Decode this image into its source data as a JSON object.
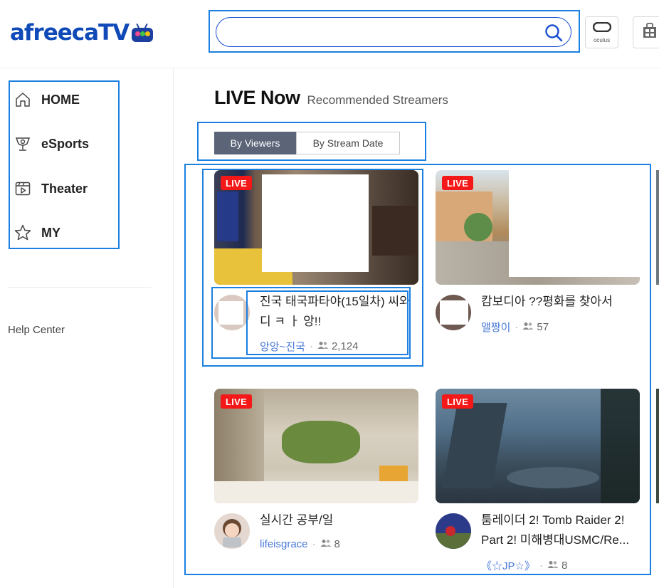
{
  "header": {
    "logo": "afreecaTV",
    "search": {
      "value": "",
      "placeholder": ""
    },
    "icons": [
      {
        "name": "oculus-icon",
        "caption": "oculus"
      },
      {
        "name": "store-icon",
        "caption": ""
      }
    ]
  },
  "sidebar": {
    "items": [
      {
        "label": "HOME",
        "icon": "home-icon"
      },
      {
        "label": "eSports",
        "icon": "trophy-icon"
      },
      {
        "label": "Theater",
        "icon": "play-icon"
      },
      {
        "label": "MY",
        "icon": "star-icon"
      }
    ],
    "help": "Help Center"
  },
  "main": {
    "title": "LIVE Now",
    "subtitle": "Recommended Streamers",
    "tabs": [
      {
        "label": "By Viewers",
        "active": true
      },
      {
        "label": "By Stream Date",
        "active": false
      }
    ],
    "badge": "LIVE",
    "cards": [
      {
        "title": "진국 태국파타야(15일차) 씨와 디 ㅋ ㅏ 앙!!",
        "nick": "앙앙~진국",
        "viewers": "2,124"
      },
      {
        "title": "캄보디아 ??평화를 찾아서",
        "nick": "앨짱이",
        "viewers": "57"
      },
      {
        "title": "실시간 공부/일",
        "nick": "lifeisgrace",
        "viewers": "8"
      },
      {
        "title": "툼레이더 2! Tomb Raider 2! Part 2! 미해병대USMC/Re...",
        "nick": "《☆JP☆》",
        "viewers": "8"
      }
    ]
  },
  "colors": {
    "brand": "#0f4ab8",
    "live": "#f41818",
    "nick": "#4a7ad8",
    "tab_active": "#5c6478",
    "highlight": "#1a7fe0"
  }
}
